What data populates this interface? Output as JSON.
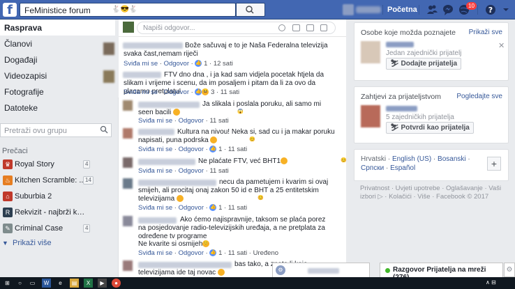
{
  "topbar": {
    "search_value": "FeMinistice forum",
    "search_emoji": "🐇😎🐇",
    "home_label": "Početna",
    "notif_count": "10"
  },
  "leftnav": {
    "items": [
      {
        "label": "Rasprava",
        "active": true
      },
      {
        "label": "Članovi"
      },
      {
        "label": "Događaji"
      },
      {
        "label": "Videozapisi"
      },
      {
        "label": "Fotografije"
      },
      {
        "label": "Datoteke"
      }
    ],
    "search_placeholder": "Pretraži ovu grupu",
    "shortcuts_header": "Prečaci",
    "shortcuts": [
      {
        "label": "Royal Story",
        "count": "4",
        "icon": "royal-story-icon",
        "color": "#c0392b"
      },
      {
        "label": "Kitchen Scramble: ...",
        "count": "14",
        "icon": "kitchen-scramble-icon",
        "color": "#e67e22"
      },
      {
        "label": "Suburbia 2",
        "count": "",
        "icon": "suburbia-icon",
        "color": "#c0392b"
      },
      {
        "label": "Rekvizit - najbrži kviz n...",
        "count": "",
        "icon": "rekvizit-icon",
        "color": "#2c3e50"
      },
      {
        "label": "Criminal Case",
        "count": "4",
        "icon": "criminal-case-icon",
        "color": "#7f8c8d"
      }
    ],
    "show_more": "Prikaži više"
  },
  "feed": {
    "reply_placeholder": "Napiši odgovor...",
    "comments": [
      {
        "text": "Bože sačuvaj e to je Naša Federalna televizija svaka čast,nemam riječi",
        "like": "Sviđa mi se",
        "reply": "Odgovor",
        "reactions": "1",
        "time": "12 sati"
      },
      {
        "text": "FTV dno dna , i ja kad sam vidjela pocetak htjela da slikam i vrijeme i scenu, da im posaljem i pitam da li za ovo da placamo pretplatu!",
        "like": "Sviđa mi se",
        "reply": "Odgovor",
        "reactions": "3",
        "time": "11 sati"
      },
      {
        "text": "Ja slikala i poslala poruku, ali samo mi seen bacili",
        "like": "Sviđa mi se",
        "reply": "Odgovor",
        "reactions": "",
        "time": "11 sati"
      },
      {
        "text": "Kultura na nivou! Neka si, sad cu i ja makar poruku napisati, puna podrska",
        "like": "Sviđa mi se",
        "reply": "Odgovor",
        "reactions": "1",
        "time": "11 sati"
      },
      {
        "text": "Ne plaćate FTV, već BHT1",
        "like": "Sviđa mi se",
        "reply": "Odgovor",
        "reactions": "",
        "time": "11 sati"
      },
      {
        "text": "necu da pametujem i kvarim si ovaj smijeh, ali procitaj onaj zakon 50 id e BHT a 25 entitetskim televizijama",
        "like": "Sviđa mi se",
        "reply": "Odgovor",
        "reactions": "1",
        "time": "11 sati"
      },
      {
        "text": "Ako ćemo najispravnije, taksom se plaća porez na posjedovanje radio-televizijskih uređaja, a ne pretplata za određene tv programe",
        "text2": "Ne kvarite si osmijeh",
        "like": "Sviđa mi se",
        "reply": "Odgovor",
        "reactions": "1",
        "time": "11 sati",
        "edited": "Uređeno"
      },
      {
        "text": "bas tako, a znate li koje televizijama ide taj novac",
        "like": "",
        "reply": "",
        "reactions": "",
        "time": ""
      }
    ]
  },
  "right": {
    "pymk_title": "Osobe koje možda poznajete",
    "pymk_link": "Prikaži sve",
    "pymk_mutual": "Jedan zajednički prijatelj",
    "pymk_button": "Dodajte prijatelja",
    "req_title": "Zahtjevi za prijateljstvom",
    "req_link": "Pogledajte sve",
    "req_mutual": "5 zajedničkih prijatelja",
    "req_button": "Potvrdi kao prijatelja",
    "languages": [
      "Hrvatski",
      "English (US)",
      "Bosanski",
      "Српски",
      "Español"
    ],
    "footer": "Privatnost · Uvjeti upotrebe · Oglašavanje · Vaši izbori ▷ · Kolačići · Više · Facebook © 2017"
  },
  "chat": {
    "label": "Razgovor Prijatelja na mreži (276)"
  }
}
